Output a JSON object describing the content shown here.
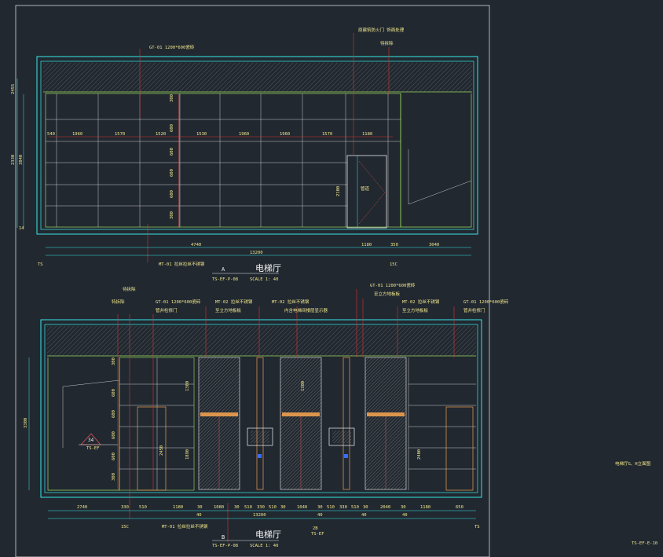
{
  "sheet": {
    "code": "TS-EF-E-10",
    "side_note": "电梯厅G、H立面图"
  },
  "elevation_a": {
    "title_chinese": "电梯厅",
    "marker": "A",
    "ref": "TS-EF-P-08",
    "scale": "SCALE 1: 40",
    "left_axis": "TS",
    "right_axis": "15C",
    "callouts": {
      "ceiling_material": "GT-01 1200*600瓷砖",
      "door_material": "原建筑防火门 饰面处理",
      "door_note": "待拆除",
      "floor_material": "MT-01 拉丝拉丝不锈钢"
    },
    "door_label": "管道",
    "door_height": "2100",
    "top_dims": [
      "540",
      "1960",
      "1570",
      "1520",
      "1530",
      "1960",
      "1960",
      "1570",
      "1180"
    ],
    "bottom_dims": [
      "4740",
      "1180",
      "350",
      "3040"
    ],
    "overall_width": "13200",
    "left_dims": [
      "2455",
      "2330",
      "3840",
      "14"
    ],
    "mid_dims": [
      "300",
      "600",
      "600",
      "600",
      "600",
      "300"
    ]
  },
  "elevation_b": {
    "title_chinese": "电梯厅",
    "marker": "B",
    "ref": "TS-EF-P-08",
    "scale": "SCALE 1: 40",
    "left_axis": "15C",
    "right_axis": "TS",
    "callouts": {
      "top_right_1": "GT-01 1200*600瓷砖",
      "top_right_2": "至立方地板板",
      "top_left_1": "待拆除",
      "top_left_2": "特拆除",
      "left_material": "GT-01 1200*600瓷砖",
      "left_sub": "管井检修门",
      "mt02_left": "MT-02 拉丝不锈钢",
      "mt02_left_sub": "至立方地板板",
      "mt02_mid": "MT-02 拉丝不锈钢",
      "mt02_mid_sub": "内含电梯间楼层显示器",
      "mt02_right": "MT-02 拉丝不锈钢",
      "mt02_right_sub": "至立方地板板",
      "gt01_right": "GT-01 1200*600瓷砖",
      "gt01_right_sub": "管井检修门",
      "floor_material": "MT-01 拉丝拉丝不锈钢",
      "section_ref": "34",
      "section_sub": "TS-EF",
      "detail_ref": "2B",
      "detail_sub": "TS-EF"
    },
    "bottom_dims": [
      "2740",
      "330",
      "510",
      "1180",
      "30",
      "1080",
      "30",
      "510",
      "330",
      "510",
      "30",
      "1040",
      "30",
      "510",
      "330",
      "510",
      "30",
      "2040",
      "30",
      "1180",
      "650"
    ],
    "sub_dims": [
      "40",
      "40",
      "40",
      "40"
    ],
    "overall_width": "13200",
    "left_dims": [
      "3300",
      "2450"
    ],
    "mid_dims": [
      "300",
      "600",
      "600",
      "600",
      "600",
      "300"
    ],
    "door_dims": [
      "1300",
      "1890",
      "2450",
      "2400"
    ]
  }
}
